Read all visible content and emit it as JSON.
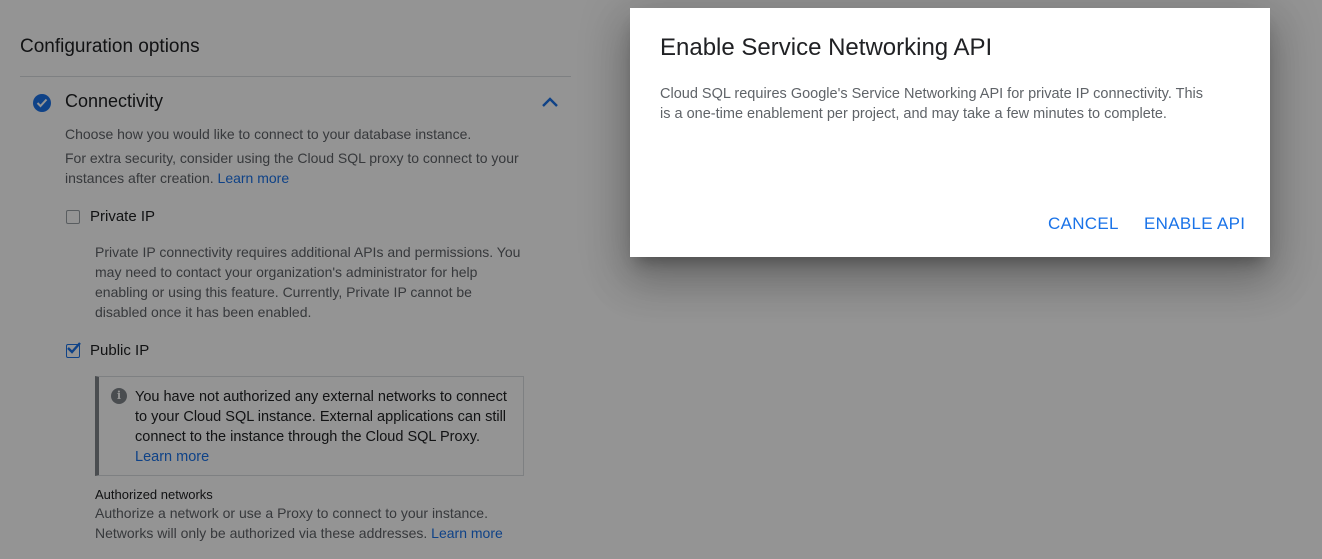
{
  "config": {
    "title": "Configuration options"
  },
  "connectivity": {
    "title": "Connectivity",
    "desc1": "Choose how you would like to connect to your database instance.",
    "desc2": "For extra security, consider using the Cloud SQL proxy to connect to your instances after creation.",
    "learn_more": "Learn more"
  },
  "private_ip": {
    "label": "Private IP",
    "checked": false,
    "desc": "Private IP connectivity requires additional APIs and permissions. You may need to contact your organization's administrator for help enabling or using this feature. Currently, Private IP cannot be disabled once it has been enabled."
  },
  "public_ip": {
    "label": "Public IP",
    "checked": true,
    "info_text": "You have not authorized any external networks to connect to your Cloud SQL instance. External applications can still connect to the instance through the Cloud SQL Proxy.",
    "learn_more": "Learn more"
  },
  "authorized_networks": {
    "title": "Authorized networks",
    "desc": "Authorize a network or use a Proxy to connect to your instance. Networks will only be authorized via these addresses.",
    "learn_more": "Learn more"
  },
  "dialog": {
    "title": "Enable Service Networking API",
    "body": "Cloud SQL requires Google's Service Networking API for private IP connectivity. This is a one-time enablement per project, and may take a few minutes to complete.",
    "cancel_label": "CANCEL",
    "enable_label": "ENABLE API"
  },
  "colors": {
    "accent": "#1a73e8",
    "overlay": "rgba(0,0,0,0.42)"
  },
  "icons": {
    "connectivity_status": "check-circle-icon",
    "collapse": "chevron-up-icon",
    "info": "info-icon",
    "checkbox_checked": "checkmark-icon"
  }
}
